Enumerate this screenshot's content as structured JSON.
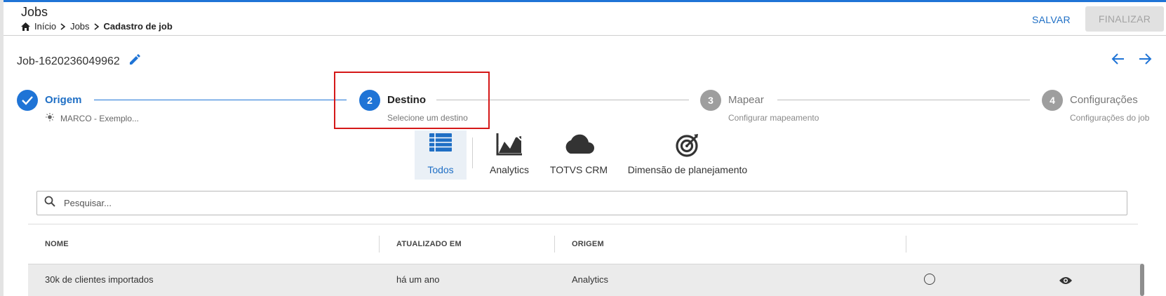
{
  "header": {
    "title": "Jobs",
    "breadcrumb": [
      "Início",
      "Jobs",
      "Cadastro de job"
    ],
    "save_label": "SALVAR",
    "finish_label": "FINALIZAR"
  },
  "job": {
    "name": "Job-1620236049962"
  },
  "colors": {
    "primary": "#1f74d6",
    "highlight": "#d51818",
    "disabled": "#e1e1e1",
    "step_inactive": "#9e9e9e"
  },
  "stepper": {
    "steps": [
      {
        "number": "1",
        "label": "Origem",
        "description": "MARCO - Exemplo...",
        "state": "done"
      },
      {
        "number": "2",
        "label": "Destino",
        "description": "Selecione um destino",
        "state": "active"
      },
      {
        "number": "3",
        "label": "Mapear",
        "description": "Configurar mapeamento",
        "state": "pending"
      },
      {
        "number": "4",
        "label": "Configurações",
        "description": "Configurações do job",
        "state": "pending"
      }
    ]
  },
  "filters": [
    {
      "label": "Todos",
      "icon": "list-icon",
      "active": true
    },
    {
      "label": "Analytics",
      "icon": "chart-icon",
      "active": false
    },
    {
      "label": "TOTVS CRM",
      "icon": "cloud-icon",
      "active": false
    },
    {
      "label": "Dimensão de planejamento",
      "icon": "target-icon",
      "active": false
    }
  ],
  "search": {
    "placeholder": "Pesquisar..."
  },
  "table": {
    "columns": [
      "NOME",
      "ATUALIZADO EM",
      "ORIGEM",
      ""
    ],
    "rows": [
      {
        "name": "30k de clientes importados",
        "updated": "há um ano",
        "origin": "Analytics",
        "selected": false
      }
    ]
  }
}
